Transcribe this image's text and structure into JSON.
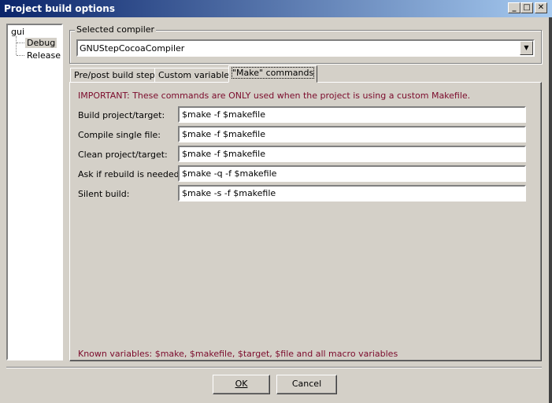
{
  "window": {
    "title": "Project build options",
    "minimize": "_",
    "maximize": "□",
    "close": "✕"
  },
  "tree": {
    "root": "gui",
    "items": [
      "Debug",
      "Release"
    ]
  },
  "compiler": {
    "group_label": "Selected compiler",
    "value": "GNUStepCocoaCompiler"
  },
  "tabs": [
    "Pre/post build steps",
    "Custom variables",
    "\"Make\" commands"
  ],
  "make": {
    "important": "IMPORTANT: These commands are ONLY used when the project is using a custom Makefile.",
    "rows": [
      {
        "label": "Build project/target:",
        "value": "$make -f  $makefile"
      },
      {
        "label": "Compile single file:",
        "value": "$make -f  $makefile"
      },
      {
        "label": "Clean project/target:",
        "value": "$make -f  $makefile"
      },
      {
        "label": "Ask if rebuild is needed:",
        "value": "$make -q -f $makefile"
      },
      {
        "label": "Silent build:",
        "value": "$make -s -f $makefile"
      }
    ],
    "known": "Known variables: $make, $makefile, $target, $file and all macro variables"
  },
  "buttons": {
    "ok": "OK",
    "cancel": "Cancel"
  }
}
